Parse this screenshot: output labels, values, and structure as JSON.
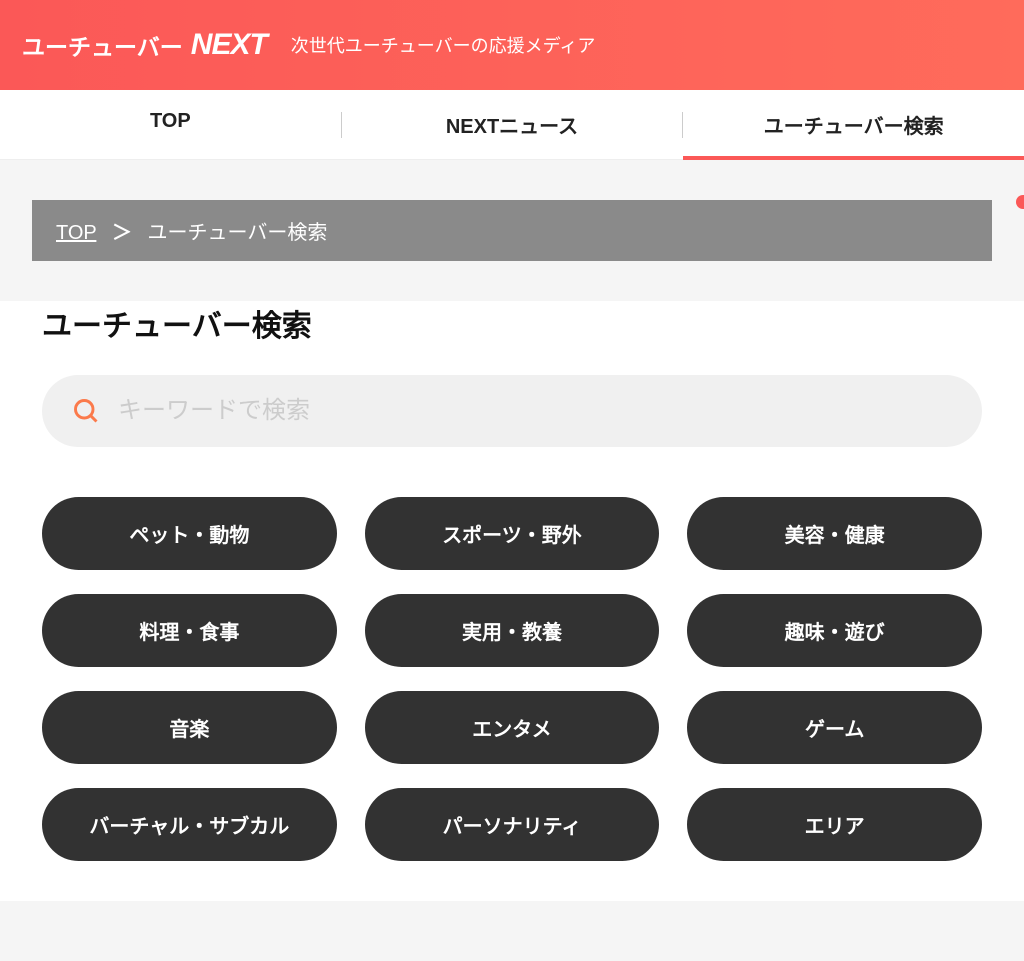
{
  "header": {
    "logo_prefix": "ユーチューバー",
    "logo_next": "NEXT",
    "tagline": "次世代ユーチューバーの応援メディア"
  },
  "nav": {
    "items": [
      {
        "label": "TOP",
        "active": false
      },
      {
        "label": "NEXTニュース",
        "active": false
      },
      {
        "label": "ユーチューバー検索",
        "active": true
      }
    ]
  },
  "breadcrumb": {
    "home": "TOP",
    "separator": "＞",
    "current": "ユーチューバー検索"
  },
  "page": {
    "title": "ユーチューバー検索"
  },
  "search": {
    "placeholder": "キーワードで検索"
  },
  "categories": [
    "ペット・動物",
    "スポーツ・野外",
    "美容・健康",
    "料理・食事",
    "実用・教養",
    "趣味・遊び",
    "音楽",
    "エンタメ",
    "ゲーム",
    "バーチャル・サブカル",
    "パーソナリティ",
    "エリア"
  ]
}
